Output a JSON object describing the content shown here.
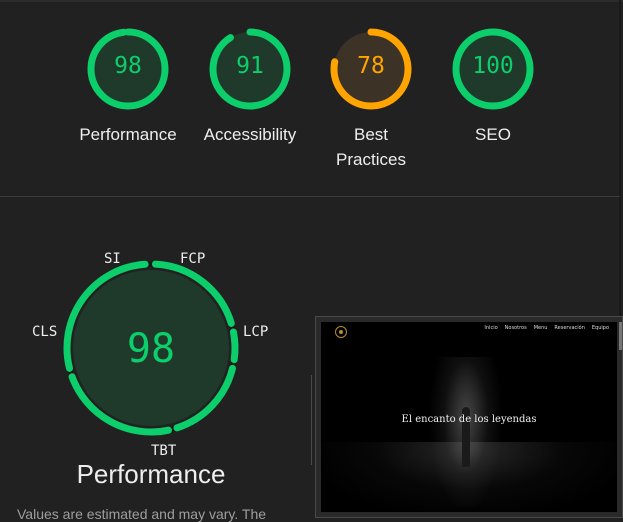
{
  "scores": [
    {
      "id": "performance",
      "value": "98",
      "label": "Performance",
      "color": "#0cce6b",
      "fill": "#1f3a2a",
      "fraction": 0.98
    },
    {
      "id": "accessibility",
      "value": "91",
      "label": "Accessibility",
      "color": "#0cce6b",
      "fill": "#1f3a2a",
      "fraction": 0.91
    },
    {
      "id": "best-practices",
      "value": "78",
      "label": "Best Practices",
      "color": "#ffa400",
      "fill": "#3c3226",
      "fraction": 0.78
    },
    {
      "id": "seo",
      "value": "100",
      "label": "SEO",
      "color": "#0cce6b",
      "fill": "#1f3a2a",
      "fraction": 1.0
    }
  ],
  "performance_detail": {
    "score": "98",
    "title": "Performance",
    "metrics": {
      "si": "SI",
      "fcp": "FCP",
      "lcp": "LCP",
      "tbt": "TBT",
      "cls": "CLS"
    },
    "disclaimer": "Values are estimated and may vary. The"
  },
  "screenshot": {
    "nav": [
      "Inicio",
      "Nosotros",
      "Menu",
      "Reservación",
      "Equipo"
    ],
    "hero_text": "El encanto de los leyendas"
  },
  "colors": {
    "pass": "#0cce6b",
    "average": "#ffa400",
    "background": "#212121"
  }
}
